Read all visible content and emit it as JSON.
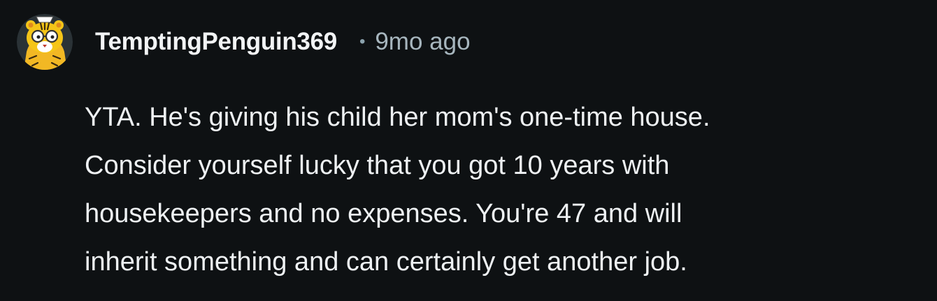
{
  "comment": {
    "author": "TemptingPenguin369",
    "separator": "•",
    "timestamp": "9mo ago",
    "avatar_icon": "tiger-avatar-icon",
    "body_lines": [
      "YTA. He's giving his child her mom's one-time house.",
      "Consider yourself lucky that you got 10 years with",
      "housekeepers and no expenses. You're 47 and will",
      "inherit something and can certainly get another job."
    ]
  },
  "colors": {
    "background": "#0e1113",
    "username": "#f2f4f5",
    "timestamp": "#a7b6be",
    "body_text": "#eef1f3",
    "avatar_accent": "#f5c518"
  }
}
